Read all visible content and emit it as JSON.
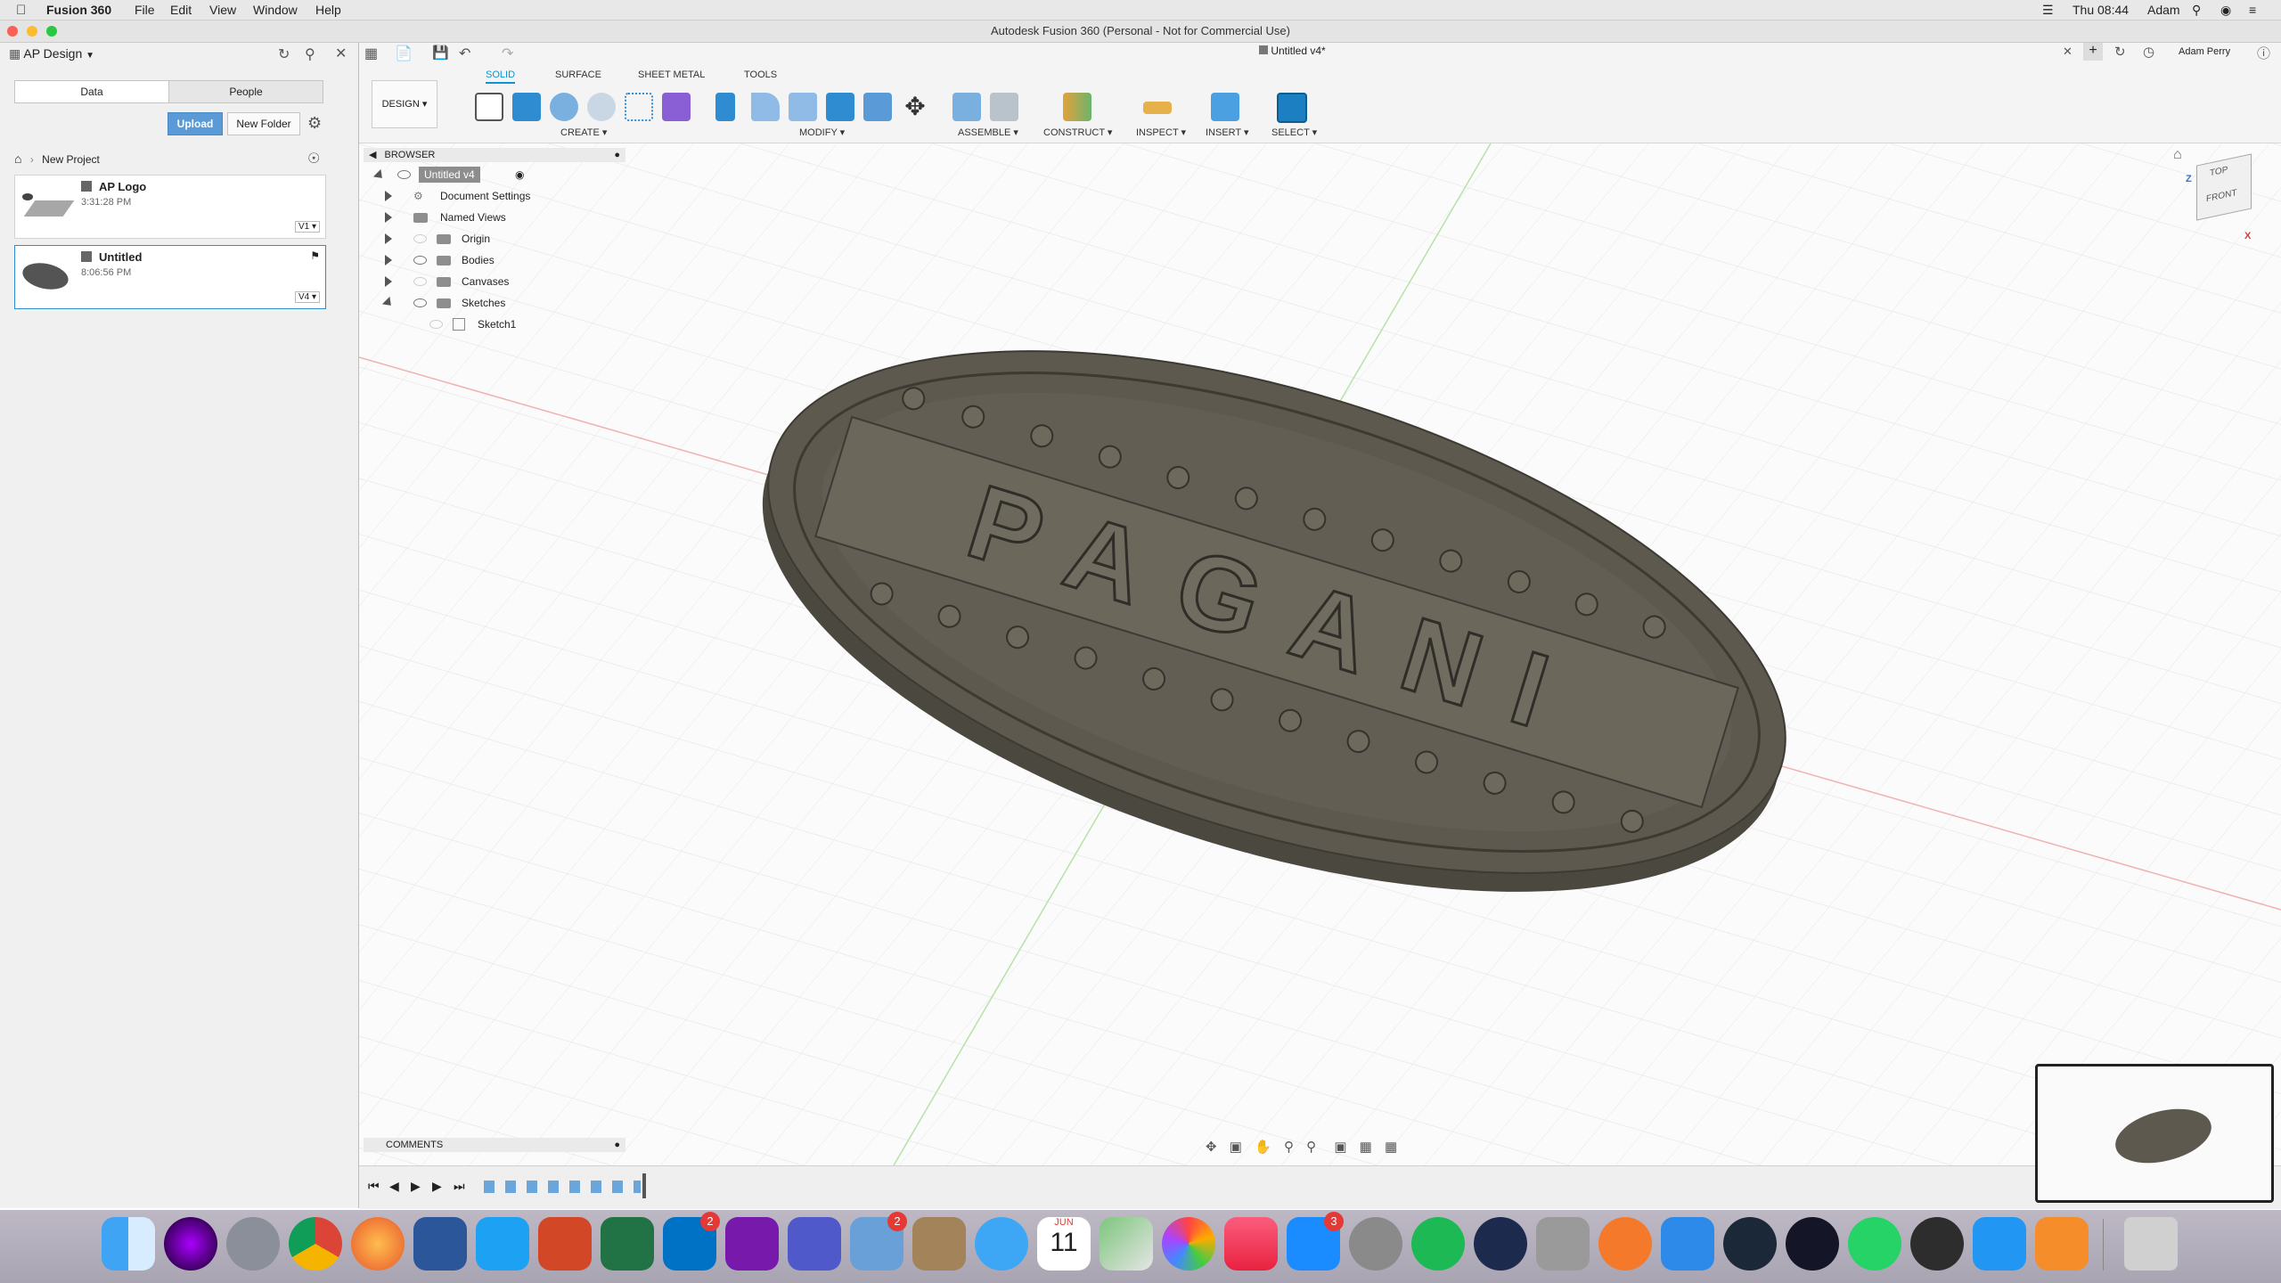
{
  "menubar": {
    "app_name": "Fusion 360",
    "items": [
      "File",
      "Edit",
      "View",
      "Window",
      "Help"
    ],
    "clock": "Thu 08:44",
    "user": "Adam"
  },
  "window": {
    "title": "Autodesk Fusion 360 (Personal - Not for Commercial Use)"
  },
  "data_panel": {
    "project_selector": "AP Design",
    "tabs": [
      "Data",
      "People"
    ],
    "upload_label": "Upload",
    "new_folder_label": "New Folder",
    "breadcrumb": "New Project",
    "files": [
      {
        "name": "AP Logo",
        "time": "3:31:28 PM",
        "version": "V1"
      },
      {
        "name": "Untitled",
        "time": "8:06:56 PM",
        "version": "V4"
      }
    ]
  },
  "document": {
    "tab_title": "Untitled v4*",
    "user": "Adam Perry"
  },
  "toolbar": {
    "workspace": "DESIGN",
    "tabs": [
      "SOLID",
      "SURFACE",
      "SHEET METAL",
      "TOOLS"
    ],
    "groups": [
      "CREATE",
      "MODIFY",
      "ASSEMBLE",
      "CONSTRUCT",
      "INSPECT",
      "INSERT",
      "SELECT"
    ]
  },
  "browser": {
    "header": "BROWSER",
    "root": "Untitled v4",
    "items": [
      "Document Settings",
      "Named Views",
      "Origin",
      "Bodies",
      "Canvases",
      "Sketches"
    ],
    "sketch": "Sketch1"
  },
  "viewcube": {
    "top": "TOP",
    "front": "FRONT",
    "x": "X",
    "z": "Z"
  },
  "comments": {
    "header": "COMMENTS"
  },
  "model": {
    "letters": "PAGANI"
  },
  "dock": {
    "badges": {
      "outlook": "2",
      "mail": "2",
      "appstore": "3"
    },
    "calendar_month": "JUN",
    "calendar_day": "11"
  },
  "colors": {
    "accent": "#0696d7",
    "model": "#585449",
    "upload": "#5a9ad6"
  }
}
